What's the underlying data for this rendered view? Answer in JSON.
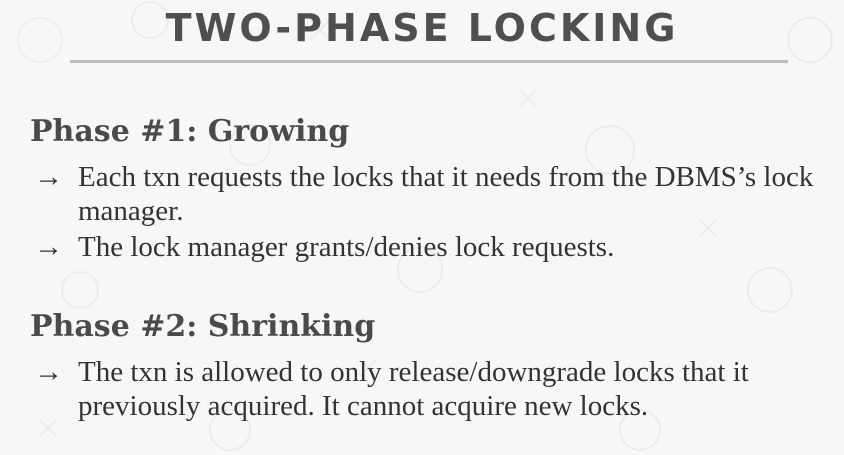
{
  "slide": {
    "title": "TWO-PHASE LOCKING"
  },
  "phases": [
    {
      "heading": "Phase #1: Growing",
      "bullets": [
        {
          "arrow": "→",
          "text": "Each txn requests the locks that it needs from the DBMS’s lock manager."
        },
        {
          "arrow": "→",
          "text": "The lock manager grants/denies lock requests."
        }
      ]
    },
    {
      "heading": "Phase #2: Shrinking",
      "bullets": [
        {
          "arrow": "→",
          "text": "The txn is allowed to only release/downgrade locks that it previously acquired. It cannot acquire new locks."
        }
      ]
    }
  ]
}
